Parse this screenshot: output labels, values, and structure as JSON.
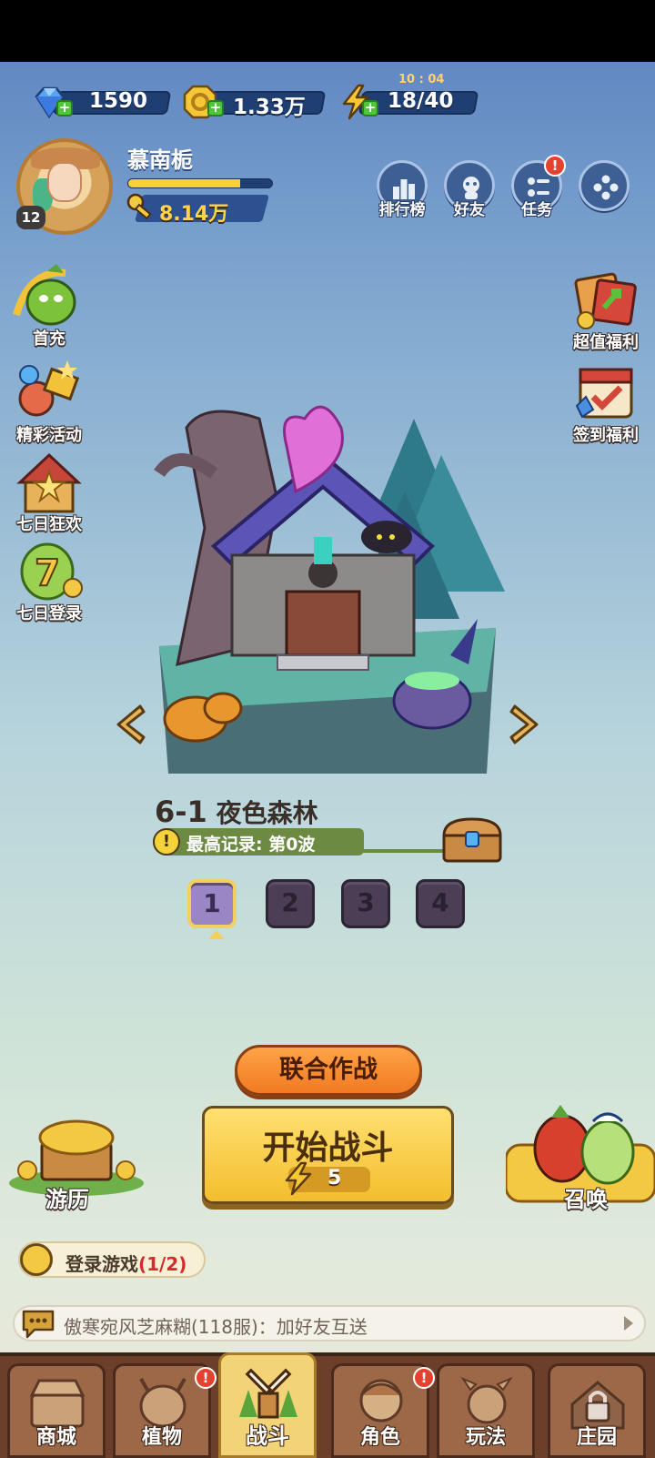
{
  "currency": {
    "gems": "1590",
    "gold": "1.33万",
    "energy": "18/40",
    "energy_timer": "10 : 04"
  },
  "player": {
    "name": "慕南栀",
    "level": "12",
    "power": "8.14万",
    "xp_progress": 0.78
  },
  "top_buttons": [
    {
      "label": "排行榜",
      "icon": "leaderboard-icon"
    },
    {
      "label": "好友",
      "icon": "friends-icon"
    },
    {
      "label": "任务",
      "icon": "tasks-icon",
      "alert": "!"
    },
    {
      "label": "",
      "icon": "gamepad-icon"
    }
  ],
  "left_side": [
    {
      "label": "首充",
      "icon": "first-recharge-icon"
    },
    {
      "label": "精彩活动",
      "icon": "events-icon"
    },
    {
      "label": "七日狂欢",
      "icon": "seven-day-carnival-icon"
    },
    {
      "label": "七日登录",
      "icon": "seven-day-login-icon",
      "badge": "7"
    }
  ],
  "right_side": [
    {
      "label": "超值福利",
      "icon": "value-bonus-icon"
    },
    {
      "label": "签到福利",
      "icon": "checkin-bonus-icon"
    }
  ],
  "stage": {
    "number": "6-1",
    "name": "夜色森林",
    "record": "最高记录: 第0波",
    "info_icon_text": "!",
    "waves": [
      "1",
      "2",
      "3",
      "4"
    ],
    "active_wave": "1"
  },
  "actions": {
    "coop": "联合作战",
    "start": "开始战斗",
    "start_cost": "5",
    "travel": "游历",
    "summon": "召唤"
  },
  "quest": {
    "text": "登录游戏",
    "progress": "(1/2)"
  },
  "chat": {
    "message": "傲寒宛风芝麻糊(118服)：加好友互送"
  },
  "nav": [
    {
      "label": "商城",
      "icon": "shop-icon"
    },
    {
      "label": "植物",
      "icon": "plants-icon",
      "alert": "!"
    },
    {
      "label": "战斗",
      "icon": "battle-icon",
      "active": true
    },
    {
      "label": "角色",
      "icon": "character-icon",
      "alert": "!"
    },
    {
      "label": "玩法",
      "icon": "gameplay-icon"
    },
    {
      "label": "庄园",
      "icon": "manor-icon",
      "locked": true
    }
  ],
  "colors": {
    "accent_yellow": "#f3be2e",
    "coop_orange": "#f17a22",
    "alert_red": "#e4412f",
    "nav_brown": "#6b3f2a"
  }
}
